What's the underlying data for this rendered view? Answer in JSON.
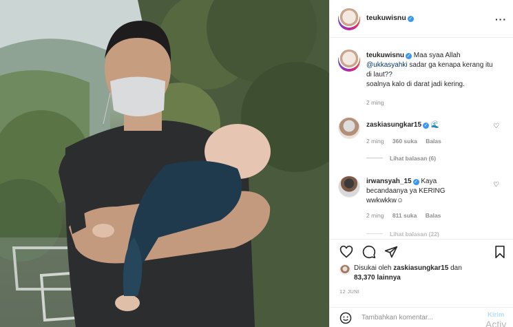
{
  "post": {
    "username": "teukuwisnu",
    "more_icon": "more-horizontal-icon"
  },
  "caption": {
    "username": "teukuwisnu",
    "text_a": "Maa syaa Allah",
    "mention": "@ukkasyahki",
    "text_b": "sadar ga kenapa kerang itu di laut??",
    "text_c": "soalnya kalo di darat jadi kering.",
    "time": "2 ming"
  },
  "comments": [
    {
      "username": "zaskiasungkar15",
      "text": "",
      "time": "2 ming",
      "likes": "360 suka",
      "reply": "Balas",
      "replies": "Lihat balasan (6)"
    },
    {
      "username": "irwansyah_15",
      "text": "Kaya becandaanya ya KERING wwkwkkw☺",
      "time": "2 ming",
      "likes": "811 suka",
      "reply": "Balas",
      "replies": "Lihat balasan (22)"
    }
  ],
  "liked_by": {
    "prefix": "Disukai oleh",
    "user": "zaskiasungkar15",
    "joiner": "dan",
    "count": "83,370 lainnya"
  },
  "date": "12 JUNI",
  "add_comment": {
    "placeholder": "Tambahkan komentar...",
    "send": "Kirim"
  },
  "overlay_watermark": "Activ"
}
